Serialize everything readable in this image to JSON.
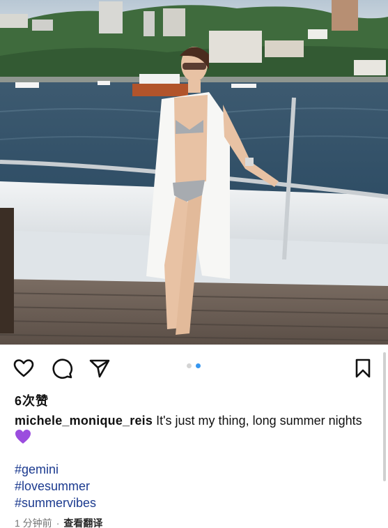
{
  "post": {
    "likes_text": "6次赞",
    "username": "michele_monique_reis",
    "caption_text": " It's just my thing, long summer nights",
    "emoji": "purple-heart",
    "hashtags": [
      "#gemini",
      "#lovesummer",
      "#summervibes"
    ],
    "time_ago": "1 分钟前",
    "separator": "·",
    "translate_label": "查看翻译"
  },
  "carousel": {
    "total": 2,
    "active_index": 1
  },
  "icons": {
    "like": "heart-icon",
    "comment": "comment-icon",
    "share": "send-icon",
    "save": "bookmark-icon"
  },
  "colors": {
    "hashtag": "#1b3a8f",
    "pager_active": "#3797f0",
    "pager_inactive": "#d4d4d4",
    "emoji_heart": "#9b4dde"
  }
}
